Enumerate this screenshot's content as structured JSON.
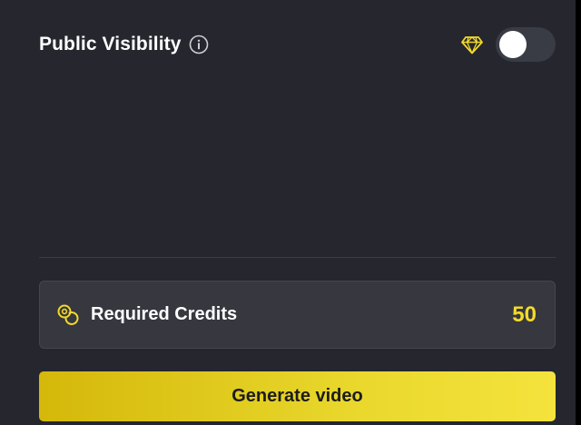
{
  "visibility": {
    "label": "Public Visibility",
    "info_icon": "info-circle-icon",
    "premium_icon": "diamond-icon",
    "toggle_state": "off"
  },
  "credits": {
    "icon": "coins-icon",
    "label": "Required Credits",
    "value": "50"
  },
  "actions": {
    "generate_label": "Generate video"
  },
  "colors": {
    "background": "#25262e",
    "accent": "#f3da2a",
    "panel": "#36373f",
    "toggle_track": "#3a3c45"
  }
}
